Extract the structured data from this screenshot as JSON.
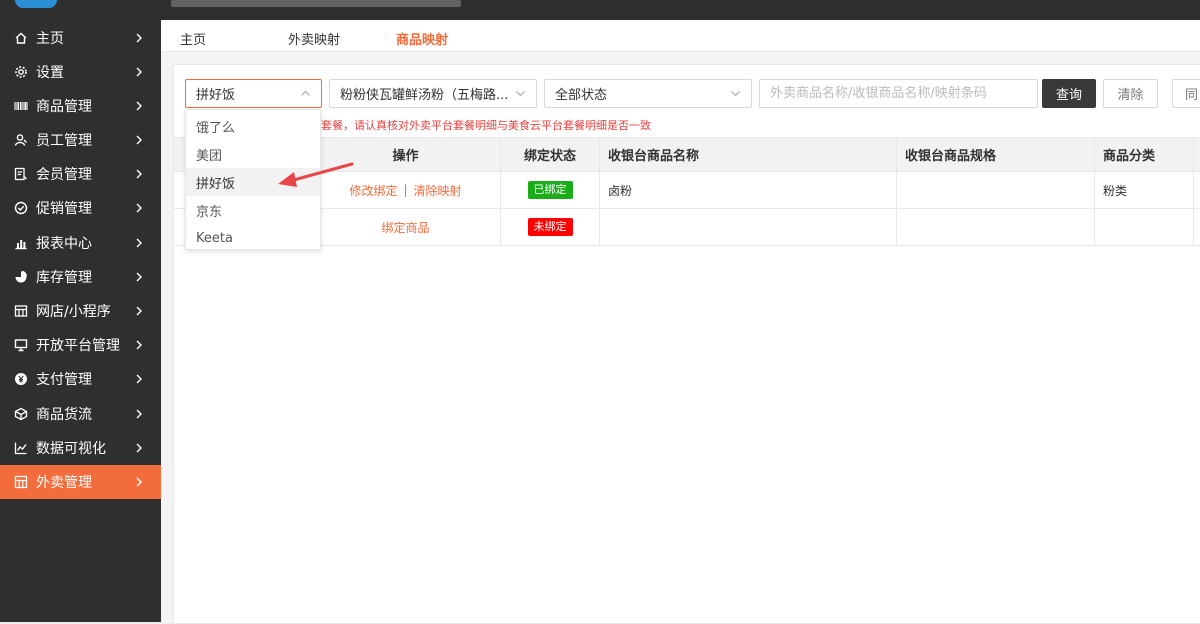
{
  "sidebar": {
    "items": [
      {
        "label": "主页",
        "icon": "home-icon"
      },
      {
        "label": "设置",
        "icon": "gear-icon"
      },
      {
        "label": "商品管理",
        "icon": "barcode-icon"
      },
      {
        "label": "员工管理",
        "icon": "staff-icon"
      },
      {
        "label": "会员管理",
        "icon": "member-icon"
      },
      {
        "label": "促销管理",
        "icon": "check-circle-icon"
      },
      {
        "label": "报表中心",
        "icon": "chart-icon"
      },
      {
        "label": "库存管理",
        "icon": "pie-icon"
      },
      {
        "label": "网店/小程序",
        "icon": "shop-icon"
      },
      {
        "label": "开放平台管理",
        "icon": "monitor-icon"
      },
      {
        "label": "支付管理",
        "icon": "yen-icon"
      },
      {
        "label": "商品货流",
        "icon": "cube-icon"
      },
      {
        "label": "数据可视化",
        "icon": "line-chart-icon"
      },
      {
        "label": "外卖管理",
        "icon": "store-icon",
        "active": true
      }
    ]
  },
  "tabs": [
    "主页",
    "外卖映射",
    "商品映射"
  ],
  "filters": {
    "platform": "拼好饭",
    "store": "粉粉侠瓦罐鲜汤粉（五梅路...",
    "status": "全部状态",
    "keyword_placeholder": "外卖商品名称/收银商品名称/映射条码",
    "query_label": "查询",
    "clear_label": "清除",
    "sync_label": "同"
  },
  "notice": "套餐，请认真核对外卖平台套餐明细与美食云平台套餐明细是否一致",
  "dropdown": {
    "options": [
      "饿了么",
      "美团",
      "拼好饭",
      "京东",
      "Keeta"
    ],
    "selected": "拼好饭"
  },
  "table": {
    "headers": [
      "操作",
      "绑定状态",
      "收银台商品名称",
      "收银台商品规格",
      "商品分类"
    ],
    "rows": [
      {
        "actions": [
          "修改绑定",
          "清除映射"
        ],
        "status": "已绑定",
        "status_color": "#1aad19",
        "name": "卤粉",
        "spec": "",
        "category": "粉类"
      },
      {
        "actions": [
          "绑定商品"
        ],
        "status": "未绑定",
        "status_color": "#ff0000",
        "name": "",
        "spec": "",
        "category": ""
      }
    ]
  },
  "colors": {
    "accent": "#f26c3c",
    "sidebar_bg": "#2f2f2f",
    "arrow": "#e8464a"
  }
}
